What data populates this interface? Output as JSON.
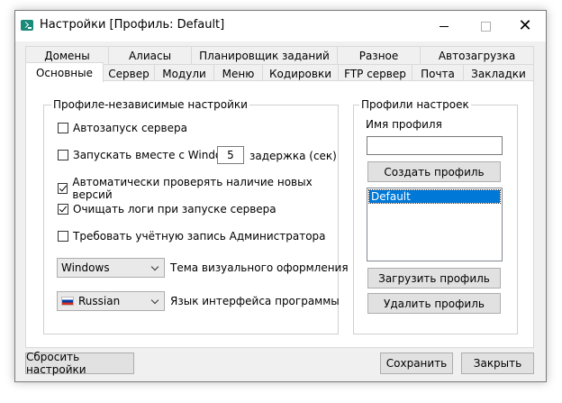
{
  "window": {
    "title": "Настройки [Профиль: Default]"
  },
  "tabs_back": [
    "Домены",
    "Алиасы",
    "Планировщик заданий",
    "Разное",
    "Автозагрузка"
  ],
  "tabs_front": [
    "Основные",
    "Сервер",
    "Модули",
    "Меню",
    "Кодировки",
    "FTP сервер",
    "Почта",
    "Закладки"
  ],
  "active_tab": "Основные",
  "left_group": {
    "title": "Профиле-независимые настройки",
    "autostart_label": "Автозапуск сервера",
    "run_with_windows_label": "Запускать вместе с Windows",
    "delay_value": "5",
    "delay_label": "задержка (сек)",
    "check_updates_label": "Автоматически проверять наличие новых версий",
    "clear_logs_label": "Очищать логи при запуске сервера",
    "require_admin_label": "Требовать учётную запись Администратора",
    "theme_value": "Windows",
    "theme_label": "Тема визуального оформления",
    "language_value": "Russian",
    "language_label": "Язык интерфейса программы"
  },
  "checkbox_states": {
    "autostart": false,
    "run_with_windows": false,
    "check_updates": true,
    "clear_logs": true,
    "require_admin": false
  },
  "right_group": {
    "title": "Профили настроек",
    "profile_name_label": "Имя профиля",
    "profile_name_value": "",
    "create_button": "Создать профиль",
    "profiles": [
      "Default"
    ],
    "load_button": "Загрузить профиль",
    "delete_button": "Удалить профиль"
  },
  "footer": {
    "reset_button": "Сбросить настройки",
    "save_button": "Сохранить",
    "close_button": "Закрыть"
  },
  "colors": {
    "selection": "#0078d7",
    "icon": "#1a8a7a"
  }
}
